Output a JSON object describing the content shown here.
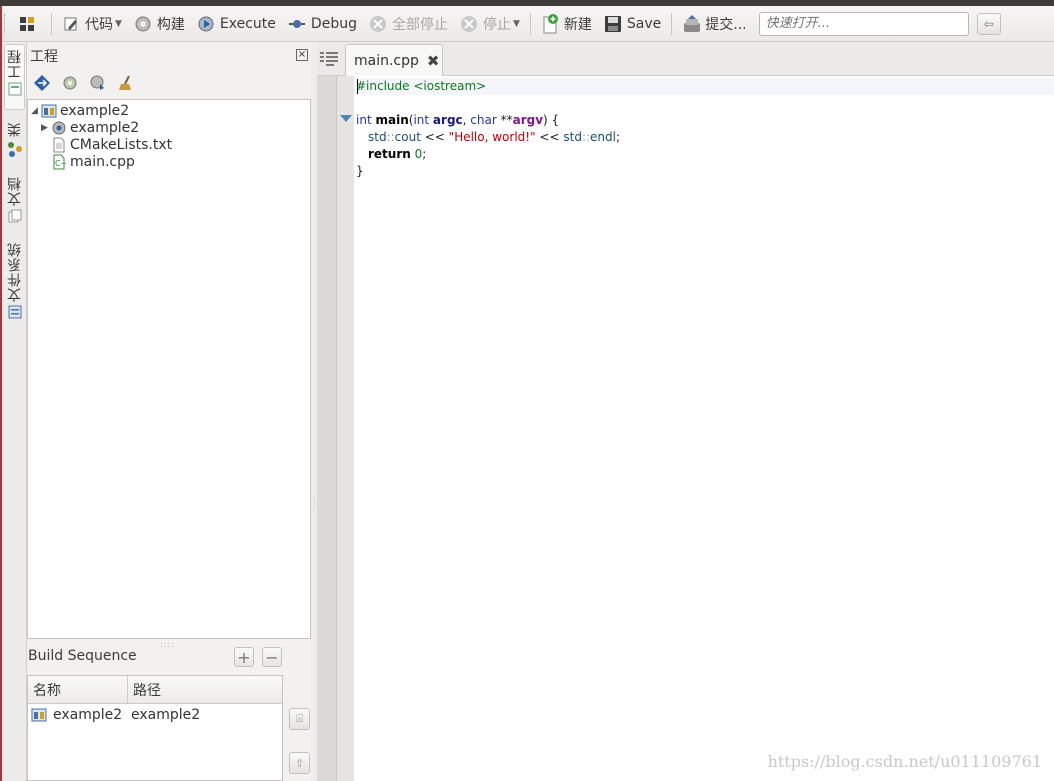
{
  "toolbar": {
    "code_label": "代码",
    "build_label": "构建",
    "execute_label": "Execute",
    "debug_label": "Debug",
    "stop_all_label": "全部停止",
    "stop_label": "停止",
    "new_label": "新建",
    "save_label": "Save",
    "commit_label": "提交...",
    "quick_open_placeholder": "快速打开..."
  },
  "side_tabs": {
    "project": "工程",
    "classes": "类",
    "documents": "文档",
    "filesystem": "文件系统"
  },
  "project_panel": {
    "title": "工程",
    "close": "×",
    "tree": [
      {
        "label": "example2",
        "type": "project",
        "expanded": true,
        "level": 0
      },
      {
        "label": "example2",
        "type": "target",
        "expanded": false,
        "level": 1
      },
      {
        "label": "CMakeLists.txt",
        "type": "text-file",
        "level": 1
      },
      {
        "label": "main.cpp",
        "type": "cpp-file",
        "level": 1
      }
    ]
  },
  "build_sequence": {
    "title": "Build Sequence",
    "columns": [
      "名称",
      "路径"
    ],
    "rows": [
      {
        "name": "example2",
        "path": "example2"
      }
    ]
  },
  "editor": {
    "tab_label": "main.cpp",
    "tab_close": "✖",
    "lines": {
      "l1_pp": "#include <iostream>",
      "l3_kw1": "int",
      "l3_fn": "main",
      "l3_p1": "(",
      "l3_kw2": "int",
      "l3_arg1": "argc",
      "l3_c": ", ",
      "l3_kw3": "char",
      "l3_star": " **",
      "l3_arg2": "argv",
      "l3_end": ") {",
      "l4_ns1": "std",
      "l4_sep1": "::",
      "l4_cout": "cout",
      "l4_op1": " << ",
      "l4_str": "\"Hello, world!\"",
      "l4_op2": " << ",
      "l4_ns2": "std",
      "l4_sep2": "::",
      "l4_endl": "endl",
      "l4_semi": ";",
      "l5_ret": "return",
      "l5_num": "0",
      "l5_semi": ";",
      "l6": "}"
    }
  },
  "watermark": "https://blog.csdn.net/u011109761"
}
